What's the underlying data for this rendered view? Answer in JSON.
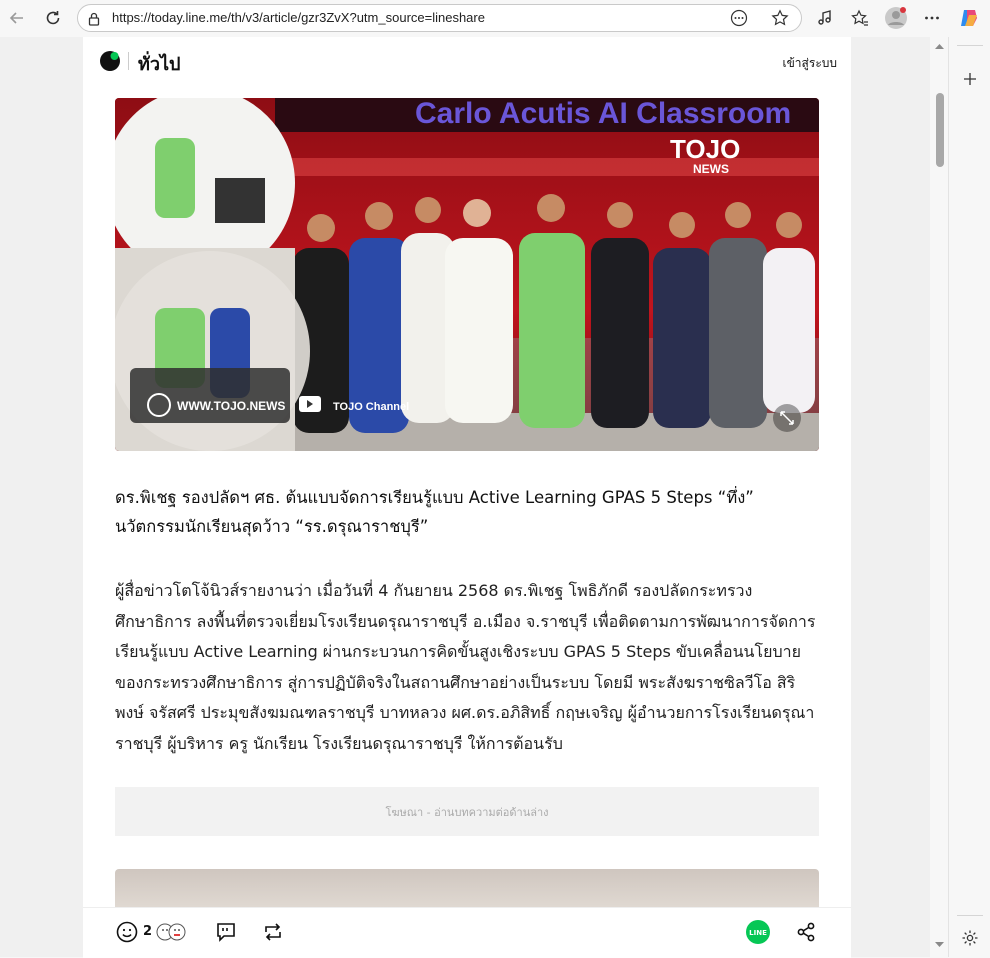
{
  "browser": {
    "url": "https://today.line.me/th/v3/article/gzr3ZvX?utm_source=lineshare"
  },
  "site": {
    "brand": "ทั่วไป",
    "login_label": "เข้าสู่ระบบ"
  },
  "hero_image": {
    "banner_text": "Carlo Acutis AI Classroom",
    "watermark": "TOJO",
    "watermark_sub": "NEWS",
    "footer_site": "WWW.TOJO.NEWS",
    "footer_channel": "TOJO Channel"
  },
  "article": {
    "headline": "ดร.พิเชฐ รองปลัดฯ ศธ. ต้นแบบจัดการเรียนรู้แบบ Active Learning GPAS 5 Steps “ทึ่ง” นวัตกรรมนักเรียนสุดว้าว “รร.ดรุณาราชบุรี”",
    "body": "ผู้สื่อข่าวโตโจ้นิวส์รายงานว่า เมื่อวันที่ 4 กันยายน 2568 ดร.พิเชฐ โพธิภักดี รองปลัดกระทรวงศึกษาธิการ ลงพื้นที่ตรวจเยี่ยมโรงเรียนดรุณาราชบุรี อ.เมือง จ.ราชบุรี เพื่อติดตามการพัฒนาการจัดการเรียนรู้แบบ Active Learning ผ่านกระบวนการคิดขั้นสูงเชิงระบบ GPAS 5 Steps ขับเคลื่อนนโยบายของกระทรวงศึกษาธิการ สู่การปฏิบัติจริงในสถานศึกษาอย่างเป็นระบบ โดยมี พระสังฆราชซิลวีโอ สิริพงษ์ จรัสศรี ประมุขสังฆมณฑลราชบุรี บาทหลวง ผศ.ดร.อภิสิทธิ์ กฤษเจริญ ผู้อำนวยการโรงเรียนดรุณาราชบุรี ผู้บริหาร ครู นักเรียน โรงเรียนดรุณาราชบุรี ให้การต้อนรับ",
    "ad_label": "โฆษณา - อ่านบทความต่อด้านล่าง"
  },
  "bottom_bar": {
    "reaction_count": "2",
    "line_label": "LINE"
  },
  "colors": {
    "line_green": "#06c755",
    "hero_red": "#b3121b"
  }
}
